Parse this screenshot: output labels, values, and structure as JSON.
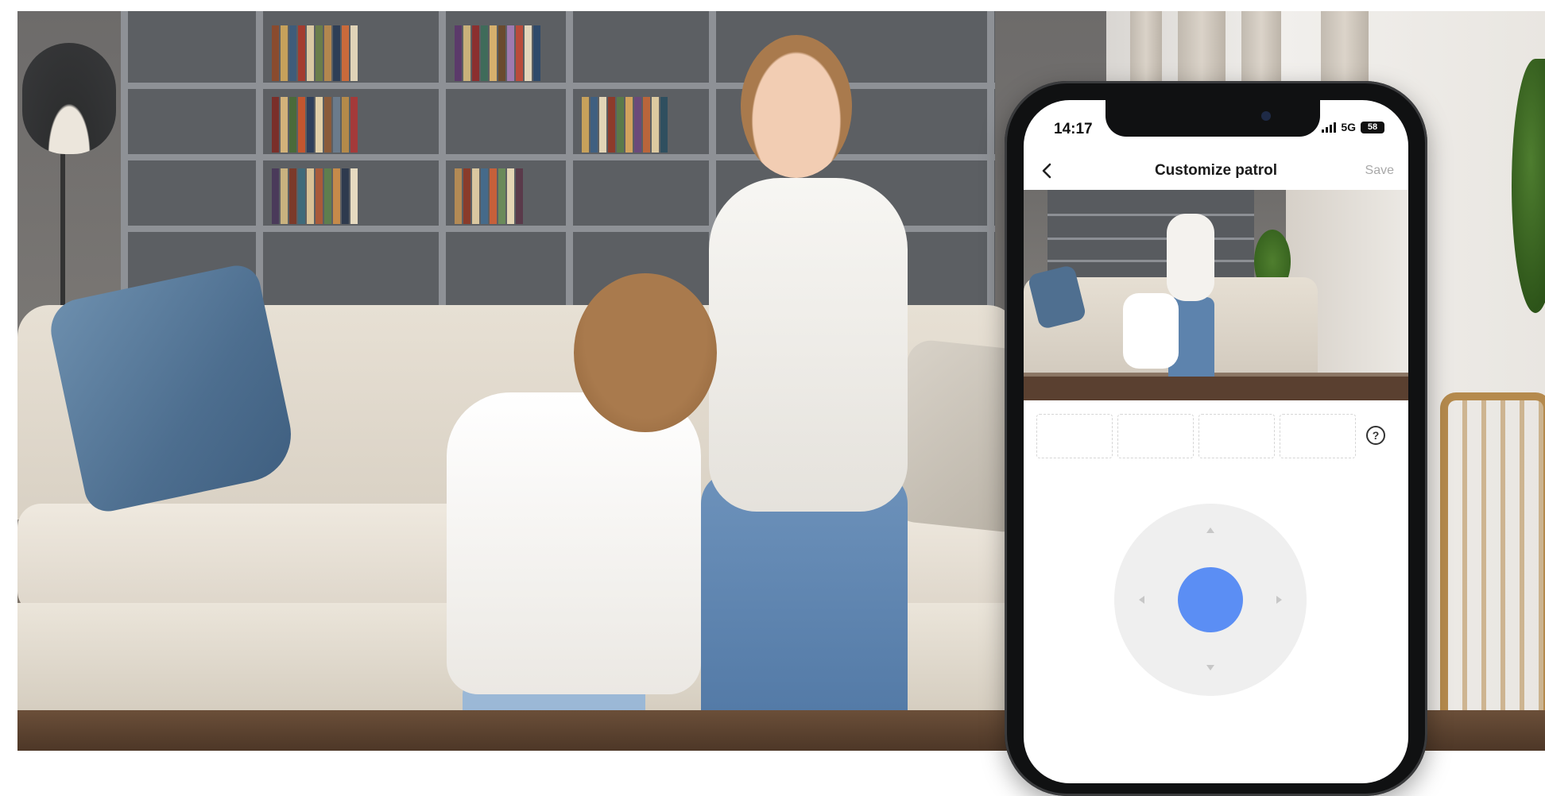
{
  "status_bar": {
    "time": "14:17",
    "network": "5G",
    "battery": "58"
  },
  "nav": {
    "title": "Customize patrol",
    "back_icon": "chevron-left-icon",
    "save_label": "Save"
  },
  "preset_slots": [
    {
      "label": ""
    },
    {
      "label": ""
    },
    {
      "label": ""
    },
    {
      "label": ""
    }
  ],
  "help": {
    "icon": "question-circle-icon",
    "symbol": "?"
  },
  "joystick": {
    "accent_color": "#5b8ef4",
    "directions": [
      "up",
      "down",
      "left",
      "right"
    ]
  },
  "colors": {
    "accent": "#5b8ef4",
    "save_disabled": "#a9a9a9",
    "phone_frame": "#101112"
  }
}
